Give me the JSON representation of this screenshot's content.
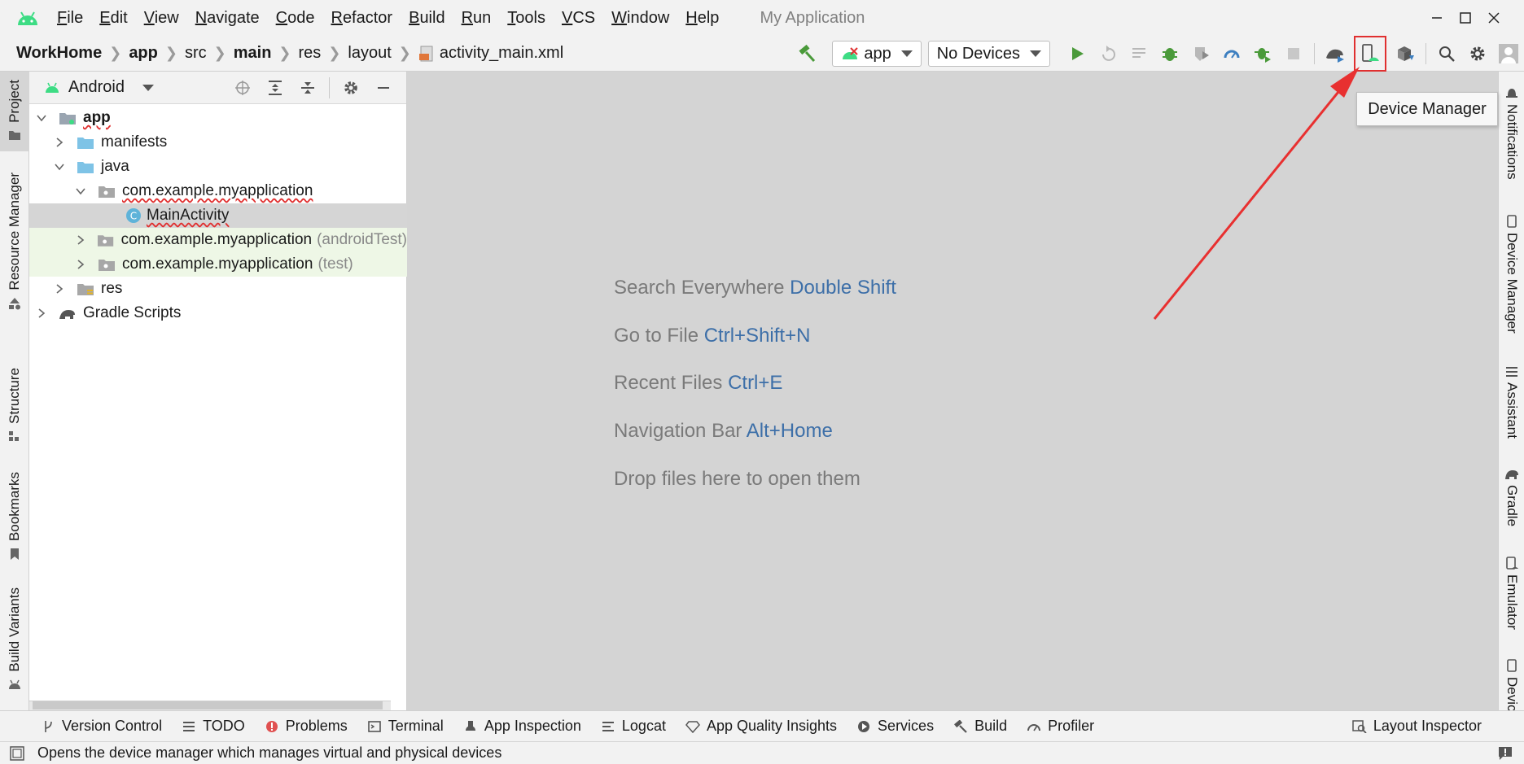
{
  "menubar": {
    "items": [
      {
        "label": "File",
        "mnemonic": "F",
        "rest": "ile"
      },
      {
        "label": "Edit",
        "mnemonic": "E",
        "rest": "dit"
      },
      {
        "label": "View",
        "mnemonic": "V",
        "rest": "iew"
      },
      {
        "label": "Navigate",
        "mnemonic": "N",
        "rest": "avigate"
      },
      {
        "label": "Code",
        "mnemonic": "C",
        "rest": "ode"
      },
      {
        "label": "Refactor",
        "mnemonic": "R",
        "rest": "efactor"
      },
      {
        "label": "Build",
        "mnemonic": "B",
        "rest": "uild"
      },
      {
        "label": "Run",
        "mnemonic": "R",
        "rest": "un"
      },
      {
        "label": "Tools",
        "mnemonic": "T",
        "rest": "ools"
      },
      {
        "label": "VCS",
        "mnemonic": "V",
        "rest": "CS"
      },
      {
        "label": "Window",
        "mnemonic": "W",
        "rest": "indow"
      },
      {
        "label": "Help",
        "mnemonic": "H",
        "rest": "elp"
      }
    ],
    "window_title": "My Application"
  },
  "breadcrumb": {
    "items": [
      "WorkHome",
      "app",
      "src",
      "main",
      "res",
      "layout",
      "activity_main.xml"
    ]
  },
  "toolbar": {
    "run_config": "app",
    "device": "No Devices"
  },
  "left_tabs": [
    "Project",
    "Resource Manager",
    "Structure",
    "Bookmarks",
    "Build Variants"
  ],
  "project_panel": {
    "view_mode": "Android",
    "tree": [
      {
        "label": "app",
        "extra": ""
      },
      {
        "label": "manifests",
        "extra": ""
      },
      {
        "label": "java",
        "extra": ""
      },
      {
        "label": "com.example.myapplication",
        "extra": ""
      },
      {
        "label": "MainActivity",
        "extra": ""
      },
      {
        "label": "com.example.myapplication",
        "extra": "(androidTest)"
      },
      {
        "label": "com.example.myapplication",
        "extra": "(test)"
      },
      {
        "label": "res",
        "extra": ""
      },
      {
        "label": "Gradle Scripts",
        "extra": ""
      }
    ]
  },
  "editor_hints": [
    {
      "text": "Search Everywhere",
      "key": "Double Shift"
    },
    {
      "text": "Go to File",
      "key": "Ctrl+Shift+N"
    },
    {
      "text": "Recent Files",
      "key": "Ctrl+E"
    },
    {
      "text": "Navigation Bar",
      "key": "Alt+Home"
    },
    {
      "text": "Drop files here to open them",
      "key": ""
    }
  ],
  "tooltip": "Device Manager",
  "right_tabs": [
    "Notifications",
    "Device Manager",
    "Assistant",
    "Gradle",
    "Emulator",
    "Device File Explorer"
  ],
  "bottom_tabs": [
    "Version Control",
    "TODO",
    "Problems",
    "Terminal",
    "App Inspection",
    "Logcat",
    "App Quality Insights",
    "Services",
    "Build",
    "Profiler"
  ],
  "bottom_right_tab": "Layout Inspector",
  "status_text": "Opens the device manager which manages virtual and physical devices",
  "colors": {
    "accent_red": "#e03030",
    "android_green": "#3ddc84",
    "hint_key": "#3d6fa8"
  }
}
